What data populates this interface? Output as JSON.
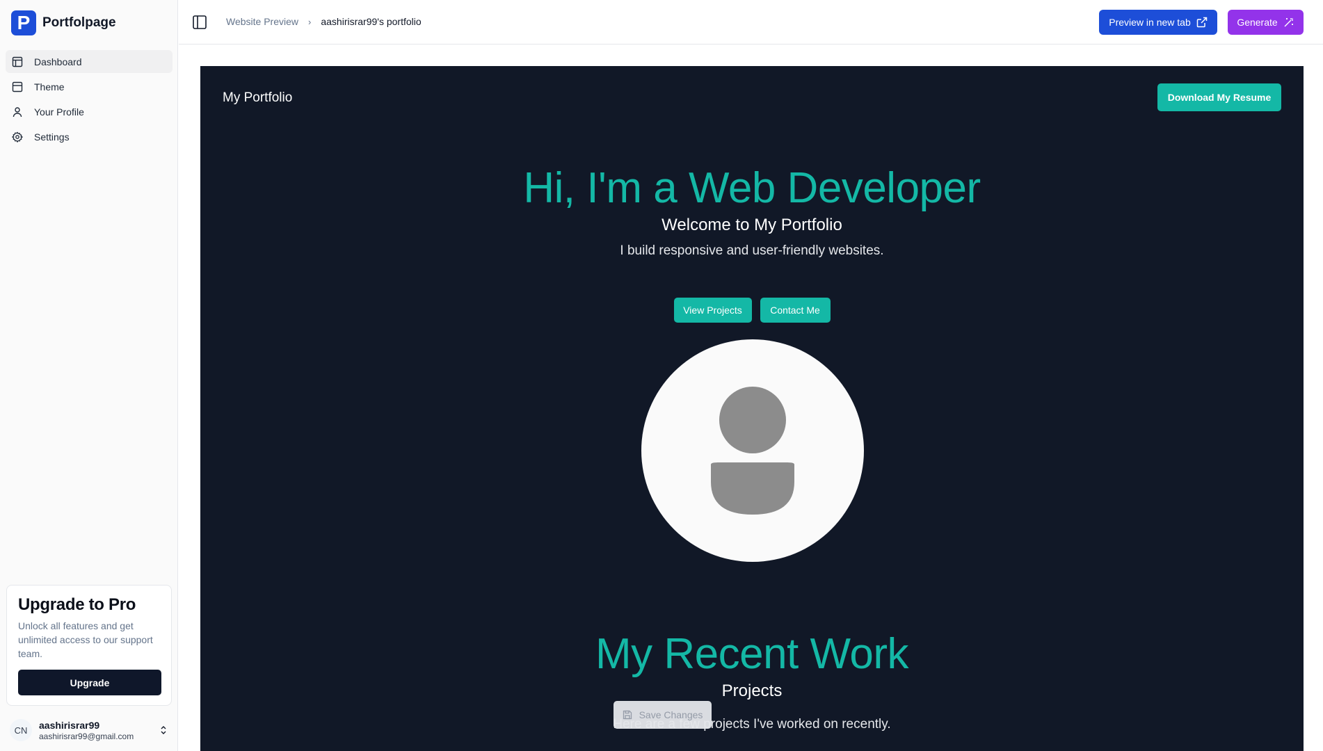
{
  "app": {
    "brand_letter": "P",
    "brand_name": "Portfolpage",
    "brand_color": "#1d4ed8"
  },
  "sidebar": {
    "items": [
      {
        "label": "Dashboard",
        "icon": "layout-dashboard-icon",
        "active": true
      },
      {
        "label": "Theme",
        "icon": "layout-template-icon",
        "active": false
      },
      {
        "label": "Your Profile",
        "icon": "user-icon",
        "active": false
      },
      {
        "label": "Settings",
        "icon": "gear-icon",
        "active": false
      }
    ],
    "upgrade": {
      "title": "Upgrade to Pro",
      "description": "Unlock all features and get unlimited access to our support team.",
      "button": "Upgrade"
    },
    "user": {
      "initials": "CN",
      "name": "aashirisrar99",
      "email": "aashirisrar99@gmail.com"
    }
  },
  "header": {
    "breadcrumb": [
      "Website Preview",
      "aashirisrar99's portfolio"
    ],
    "preview_button": "Preview in new tab",
    "generate_button": "Generate",
    "preview_color": "#1d4ed8",
    "generate_color": "#9333ea"
  },
  "preview": {
    "nav_title": "My Portfolio",
    "resume_button": "Download My Resume",
    "hero_title": "Hi, I'm a Web Developer",
    "hero_subtitle": "Welcome to My Portfolio",
    "hero_text": "I build responsive and user-friendly websites.",
    "buttons": [
      "View Projects",
      "Contact Me"
    ],
    "work_title": "My Recent Work",
    "work_subtitle": "Projects",
    "work_text": "Here are a few projects I've worked on recently.",
    "accent_color": "#14b8a6",
    "background_color": "#111827"
  },
  "save_button": "Save Changes"
}
